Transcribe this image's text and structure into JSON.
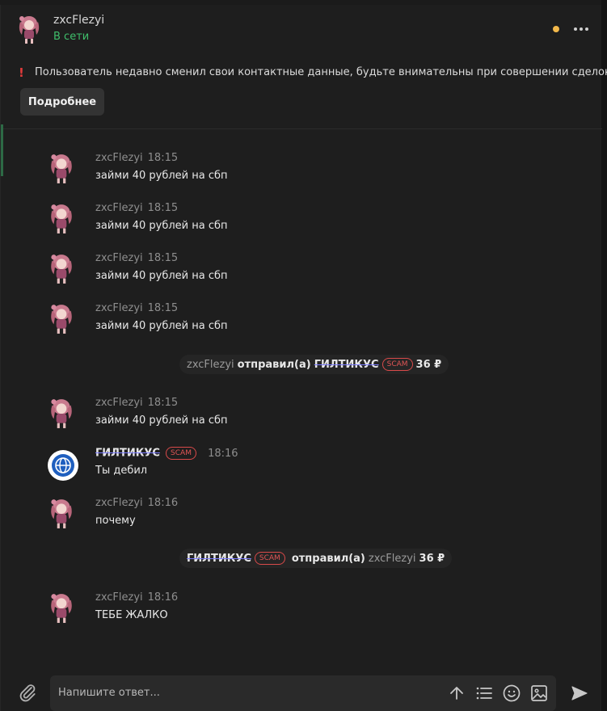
{
  "header": {
    "name": "zxcFlezyi",
    "status": "В сети",
    "status_color": "#3fbf6b",
    "presence_dot_color": "#f2b84b"
  },
  "warning": {
    "icon": "exclamation-icon",
    "text": "Пользователь недавно сменил свои контактные данные, будьте внимательны при совершении сделок.",
    "button": "Подробнее"
  },
  "messages": [
    {
      "author": "zxcFlezyi",
      "time": "18:15",
      "text": "займи 40 рублей на сбп"
    },
    {
      "author": "zxcFlezyi",
      "time": "18:15",
      "text": "займи 40 рублей на сбп"
    },
    {
      "author": "zxcFlezyi",
      "time": "18:15",
      "text": "займи 40 рублей на сбп"
    },
    {
      "author": "zxcFlezyi",
      "time": "18:15",
      "text": "займи 40 рублей на сбп"
    },
    {
      "author": "zxcFlezyi",
      "time": "18:15",
      "text": "займи 40 рублей на сбп"
    },
    {
      "author": "ГИЛТИКУС",
      "badge": "SCAM",
      "time": "18:16",
      "text": "Ты дебил"
    },
    {
      "author": "zxcFlezyi",
      "time": "18:16",
      "text": "почему"
    },
    {
      "author": "zxcFlezyi",
      "time": "18:16",
      "text": "ТЕБЕ ЖАЛКО"
    }
  ],
  "system_events": [
    {
      "sender": "zxcFlezyi",
      "action": "отправил(а)",
      "recipient": "ГИЛТИКУС",
      "badge": "SCAM",
      "amount": "36 ₽"
    },
    {
      "sender": "ГИЛТИКУС",
      "badge": "SCAM",
      "action": "отправил(а)",
      "recipient": "zxcFlezyi",
      "amount": "36 ₽"
    }
  ],
  "composer": {
    "placeholder": "Напишите ответ...",
    "tools": [
      "arrow-up-icon",
      "list-icon",
      "smile-icon",
      "image-icon"
    ],
    "send_icon": "send-icon",
    "attach_icon": "paperclip-icon"
  }
}
